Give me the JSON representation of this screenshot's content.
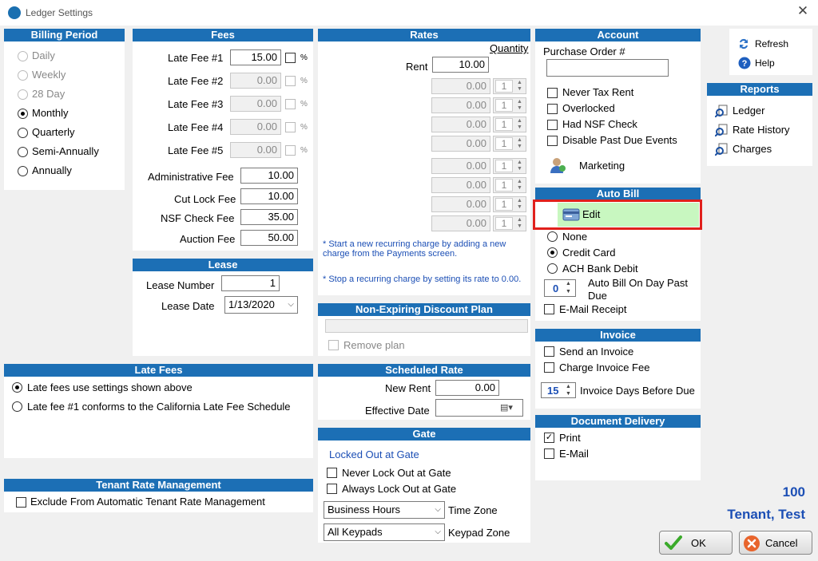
{
  "window": {
    "title": "Ledger Settings"
  },
  "billing_period": {
    "title": "Billing Period",
    "options": [
      "Daily",
      "Weekly",
      "28 Day",
      "Monthly",
      "Quarterly",
      "Semi-Annually",
      "Annually"
    ],
    "selected": "Monthly"
  },
  "fees": {
    "title": "Fees",
    "late_fee_1_label": "Late Fee #1",
    "late_fee_1_value": "15.00",
    "late_fee_2_label": "Late Fee #2",
    "late_fee_2_value": "0.00",
    "late_fee_3_label": "Late Fee #3",
    "late_fee_3_value": "0.00",
    "late_fee_4_label": "Late Fee #4",
    "late_fee_4_value": "0.00",
    "late_fee_5_label": "Late Fee #5",
    "late_fee_5_value": "0.00",
    "percent_symbol": "%",
    "admin_fee_label": "Administrative Fee",
    "admin_fee_value": "10.00",
    "cut_lock_label": "Cut Lock Fee",
    "cut_lock_value": "10.00",
    "nsf_label": "NSF Check Fee",
    "nsf_value": "35.00",
    "auction_label": "Auction Fee",
    "auction_value": "50.00"
  },
  "rates": {
    "title": "Rates",
    "quantity_label": "Quantity",
    "rent_label": "Rent",
    "rent_value": "10.00",
    "charge_value": "0.00",
    "qty_value": "1",
    "note1": "* Start a new recurring charge by adding a new charge from the Payments screen.",
    "note2": "* Stop a recurring charge by setting its rate to 0.00."
  },
  "account": {
    "title": "Account",
    "po_label": "Purchase Order #",
    "po_value": "",
    "never_tax": "Never Tax Rent",
    "overlocked": "Overlocked",
    "had_nsf": "Had NSF Check",
    "disable_past_due": "Disable Past Due Events",
    "marketing": "Marketing"
  },
  "toolbar": {
    "refresh": "Refresh",
    "help": "Help"
  },
  "reports": {
    "title": "Reports",
    "ledger": "Ledger",
    "rate_history": "Rate History",
    "charges": "Charges"
  },
  "lease": {
    "title": "Lease",
    "number_label": "Lease Number",
    "number_value": "1",
    "date_label": "Lease Date",
    "date_value": "1/13/2020"
  },
  "discount": {
    "title": "Non-Expiring Discount Plan",
    "remove_plan": "Remove plan"
  },
  "auto_bill": {
    "title": "Auto Bill",
    "edit": "Edit",
    "none": "None",
    "credit_card": "Credit Card",
    "ach": "ACH Bank Debit",
    "day_value": "0",
    "day_label": "Auto Bill On Day Past Due",
    "email_receipt": "E-Mail Receipt"
  },
  "invoice": {
    "title": "Invoice",
    "send": "Send an Invoice",
    "charge_fee": "Charge Invoice Fee",
    "days_value": "15",
    "days_label": "Invoice Days Before Due"
  },
  "late_fees": {
    "title": "Late Fees",
    "option1": "Late fees use settings shown above",
    "option2": "Late fee #1 conforms to the California Late Fee Schedule"
  },
  "scheduled_rate": {
    "title": "Scheduled Rate",
    "new_rent_label": "New Rent",
    "new_rent_value": "0.00",
    "effective_label": "Effective Date",
    "effective_value": ""
  },
  "gate": {
    "title": "Gate",
    "status": "Locked Out at Gate",
    "never_lock": "Never Lock Out at Gate",
    "always_lock": "Always Lock Out at Gate",
    "timezone_value": "Business Hours",
    "timezone_label": "Time Zone",
    "keypad_value": "All Keypads",
    "keypad_label": "Keypad Zone"
  },
  "document_delivery": {
    "title": "Document Delivery",
    "print": "Print",
    "email": "E-Mail"
  },
  "tenant_rate": {
    "title": "Tenant Rate Management",
    "exclude": "Exclude From Automatic Tenant Rate Management"
  },
  "tenant": {
    "id": "100",
    "name": "Tenant, Test"
  },
  "buttons": {
    "ok": "OK",
    "cancel": "Cancel"
  },
  "colors": {
    "header_blue": "#1c6fb5",
    "highlight_red": "#e0201c",
    "edit_green": "#c8f7c0",
    "tenant_blue": "#1c4fb5"
  }
}
